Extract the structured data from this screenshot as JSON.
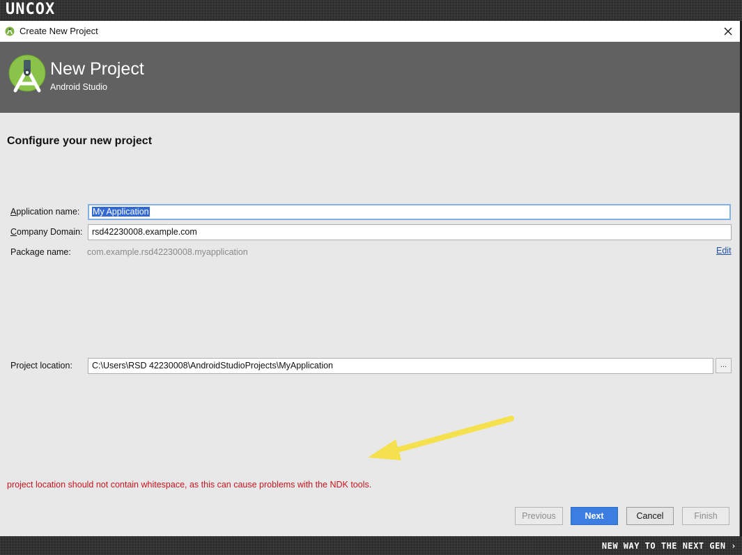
{
  "branding": {
    "logo_text": "UNCOX",
    "tagline": "NEW WAY TO THE NEXT GEN ›"
  },
  "window": {
    "title": "Create New Project",
    "close_icon": "close-icon"
  },
  "header": {
    "title": "New Project",
    "subtitle": "Android Studio",
    "logo_icon": "android-studio-logo-icon"
  },
  "form": {
    "section_title": "Configure your new project",
    "app_name": {
      "label_access": "A",
      "label_rest": "pplication name:",
      "value": "My Application"
    },
    "company_domain": {
      "label_access": "C",
      "label_rest": "ompany Domain:",
      "value": "rsd42230008.example.com"
    },
    "package_name": {
      "label": "Package name:",
      "value": "com.example.rsd42230008.myapplication",
      "edit_label": "Edit"
    },
    "project_location": {
      "label": "Project location:",
      "value": "C:\\Users\\RSD 42230008\\AndroidStudioProjects\\MyApplication",
      "browse_label": "..."
    }
  },
  "error": {
    "message": "project location should not contain whitespace, as this can cause problems with the NDK tools."
  },
  "buttons": {
    "previous": "Previous",
    "next": "Next",
    "cancel": "Cancel",
    "finish": "Finish"
  },
  "colors": {
    "header_bg": "#616161",
    "error": "#c8141e",
    "primary_button": "#3b7de0",
    "selection": "#3369d4",
    "annotation_arrow": "#f5e14d"
  }
}
